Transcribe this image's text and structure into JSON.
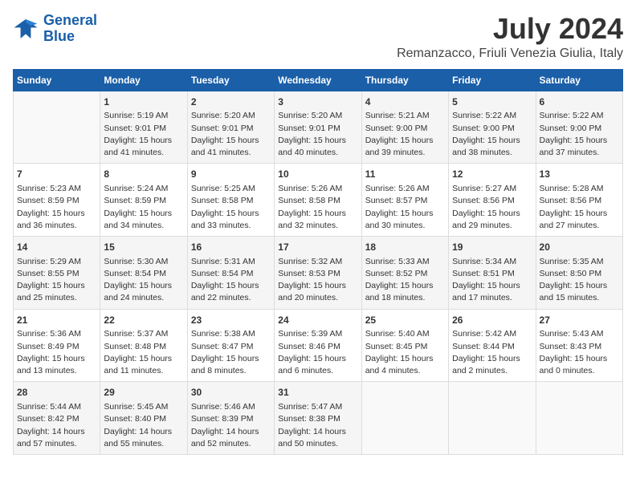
{
  "logo": {
    "line1": "General",
    "line2": "Blue"
  },
  "title": "July 2024",
  "location": "Remanzacco, Friuli Venezia Giulia, Italy",
  "weekdays": [
    "Sunday",
    "Monday",
    "Tuesday",
    "Wednesday",
    "Thursday",
    "Friday",
    "Saturday"
  ],
  "weeks": [
    [
      {
        "day": "",
        "info": ""
      },
      {
        "day": "1",
        "info": "Sunrise: 5:19 AM\nSunset: 9:01 PM\nDaylight: 15 hours\nand 41 minutes."
      },
      {
        "day": "2",
        "info": "Sunrise: 5:20 AM\nSunset: 9:01 PM\nDaylight: 15 hours\nand 41 minutes."
      },
      {
        "day": "3",
        "info": "Sunrise: 5:20 AM\nSunset: 9:01 PM\nDaylight: 15 hours\nand 40 minutes."
      },
      {
        "day": "4",
        "info": "Sunrise: 5:21 AM\nSunset: 9:00 PM\nDaylight: 15 hours\nand 39 minutes."
      },
      {
        "day": "5",
        "info": "Sunrise: 5:22 AM\nSunset: 9:00 PM\nDaylight: 15 hours\nand 38 minutes."
      },
      {
        "day": "6",
        "info": "Sunrise: 5:22 AM\nSunset: 9:00 PM\nDaylight: 15 hours\nand 37 minutes."
      }
    ],
    [
      {
        "day": "7",
        "info": "Sunrise: 5:23 AM\nSunset: 8:59 PM\nDaylight: 15 hours\nand 36 minutes."
      },
      {
        "day": "8",
        "info": "Sunrise: 5:24 AM\nSunset: 8:59 PM\nDaylight: 15 hours\nand 34 minutes."
      },
      {
        "day": "9",
        "info": "Sunrise: 5:25 AM\nSunset: 8:58 PM\nDaylight: 15 hours\nand 33 minutes."
      },
      {
        "day": "10",
        "info": "Sunrise: 5:26 AM\nSunset: 8:58 PM\nDaylight: 15 hours\nand 32 minutes."
      },
      {
        "day": "11",
        "info": "Sunrise: 5:26 AM\nSunset: 8:57 PM\nDaylight: 15 hours\nand 30 minutes."
      },
      {
        "day": "12",
        "info": "Sunrise: 5:27 AM\nSunset: 8:56 PM\nDaylight: 15 hours\nand 29 minutes."
      },
      {
        "day": "13",
        "info": "Sunrise: 5:28 AM\nSunset: 8:56 PM\nDaylight: 15 hours\nand 27 minutes."
      }
    ],
    [
      {
        "day": "14",
        "info": "Sunrise: 5:29 AM\nSunset: 8:55 PM\nDaylight: 15 hours\nand 25 minutes."
      },
      {
        "day": "15",
        "info": "Sunrise: 5:30 AM\nSunset: 8:54 PM\nDaylight: 15 hours\nand 24 minutes."
      },
      {
        "day": "16",
        "info": "Sunrise: 5:31 AM\nSunset: 8:54 PM\nDaylight: 15 hours\nand 22 minutes."
      },
      {
        "day": "17",
        "info": "Sunrise: 5:32 AM\nSunset: 8:53 PM\nDaylight: 15 hours\nand 20 minutes."
      },
      {
        "day": "18",
        "info": "Sunrise: 5:33 AM\nSunset: 8:52 PM\nDaylight: 15 hours\nand 18 minutes."
      },
      {
        "day": "19",
        "info": "Sunrise: 5:34 AM\nSunset: 8:51 PM\nDaylight: 15 hours\nand 17 minutes."
      },
      {
        "day": "20",
        "info": "Sunrise: 5:35 AM\nSunset: 8:50 PM\nDaylight: 15 hours\nand 15 minutes."
      }
    ],
    [
      {
        "day": "21",
        "info": "Sunrise: 5:36 AM\nSunset: 8:49 PM\nDaylight: 15 hours\nand 13 minutes."
      },
      {
        "day": "22",
        "info": "Sunrise: 5:37 AM\nSunset: 8:48 PM\nDaylight: 15 hours\nand 11 minutes."
      },
      {
        "day": "23",
        "info": "Sunrise: 5:38 AM\nSunset: 8:47 PM\nDaylight: 15 hours\nand 8 minutes."
      },
      {
        "day": "24",
        "info": "Sunrise: 5:39 AM\nSunset: 8:46 PM\nDaylight: 15 hours\nand 6 minutes."
      },
      {
        "day": "25",
        "info": "Sunrise: 5:40 AM\nSunset: 8:45 PM\nDaylight: 15 hours\nand 4 minutes."
      },
      {
        "day": "26",
        "info": "Sunrise: 5:42 AM\nSunset: 8:44 PM\nDaylight: 15 hours\nand 2 minutes."
      },
      {
        "day": "27",
        "info": "Sunrise: 5:43 AM\nSunset: 8:43 PM\nDaylight: 15 hours\nand 0 minutes."
      }
    ],
    [
      {
        "day": "28",
        "info": "Sunrise: 5:44 AM\nSunset: 8:42 PM\nDaylight: 14 hours\nand 57 minutes."
      },
      {
        "day": "29",
        "info": "Sunrise: 5:45 AM\nSunset: 8:40 PM\nDaylight: 14 hours\nand 55 minutes."
      },
      {
        "day": "30",
        "info": "Sunrise: 5:46 AM\nSunset: 8:39 PM\nDaylight: 14 hours\nand 52 minutes."
      },
      {
        "day": "31",
        "info": "Sunrise: 5:47 AM\nSunset: 8:38 PM\nDaylight: 14 hours\nand 50 minutes."
      },
      {
        "day": "",
        "info": ""
      },
      {
        "day": "",
        "info": ""
      },
      {
        "day": "",
        "info": ""
      }
    ]
  ]
}
